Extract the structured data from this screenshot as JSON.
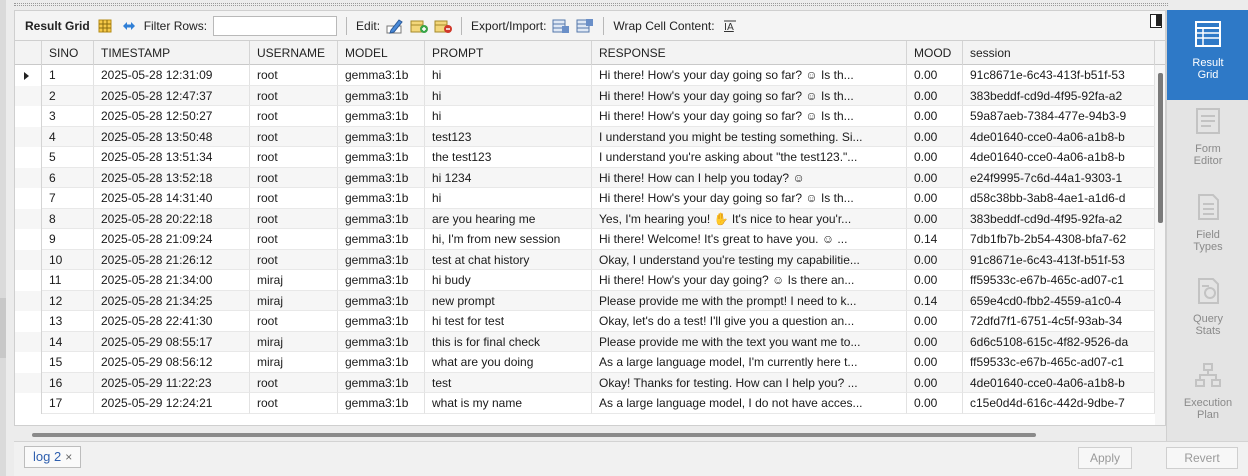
{
  "toolbar": {
    "result_grid_label": "Result Grid",
    "filter_rows_label": "Filter Rows:",
    "filter_value": "",
    "edit_label": "Edit:",
    "export_import_label": "Export/Import:",
    "wrap_cell_label": "Wrap Cell Content:"
  },
  "grid": {
    "columns": [
      "SINO",
      "TIMESTAMP",
      "USERNAME",
      "MODEL",
      "PROMPT",
      "RESPONSE",
      "MOOD",
      "session"
    ],
    "rows": [
      {
        "sino": "1",
        "timestamp": "2025-05-28 12:31:09",
        "username": "root",
        "model": "gemma3:1b",
        "prompt": "hi",
        "response": "Hi there! How's your day going so far? ☺ Is th...",
        "mood": "0.00",
        "session": "91c8671e-6c43-413f-b51f-53"
      },
      {
        "sino": "2",
        "timestamp": "2025-05-28 12:47:37",
        "username": "root",
        "model": "gemma3:1b",
        "prompt": "hi",
        "response": "Hi there! How's your day going so far? ☺ Is th...",
        "mood": "0.00",
        "session": "383beddf-cd9d-4f95-92fa-a2"
      },
      {
        "sino": "3",
        "timestamp": "2025-05-28 12:50:27",
        "username": "root",
        "model": "gemma3:1b",
        "prompt": "hi",
        "response": "Hi there! How's your day going so far? ☺ Is th...",
        "mood": "0.00",
        "session": "59a87aeb-7384-477e-94b3-9"
      },
      {
        "sino": "4",
        "timestamp": "2025-05-28 13:50:48",
        "username": "root",
        "model": "gemma3:1b",
        "prompt": "test123",
        "response": "I understand you might be testing something. Si...",
        "mood": "0.00",
        "session": "4de01640-cce0-4a06-a1b8-b"
      },
      {
        "sino": "5",
        "timestamp": "2025-05-28 13:51:34",
        "username": "root",
        "model": "gemma3:1b",
        "prompt": "the test123",
        "response": "I understand you're asking about \"the test123.\"...",
        "mood": "0.00",
        "session": "4de01640-cce0-4a06-a1b8-b"
      },
      {
        "sino": "6",
        "timestamp": "2025-05-28 13:52:18",
        "username": "root",
        "model": "gemma3:1b",
        "prompt": "hi 1234",
        "response": "Hi there! How can I help you today? ☺",
        "mood": "0.00",
        "session": "e24f9995-7c6d-44a1-9303-1"
      },
      {
        "sino": "7",
        "timestamp": "2025-05-28 14:31:40",
        "username": "root",
        "model": "gemma3:1b",
        "prompt": "hi",
        "response": "Hi there! How's your day going so far? ☺ Is th...",
        "mood": "0.00",
        "session": "d58c38bb-3ab8-4ae1-a1d6-d"
      },
      {
        "sino": "8",
        "timestamp": "2025-05-28 20:22:18",
        "username": "root",
        "model": "gemma3:1b",
        "prompt": "are you hearing me",
        "response": "Yes, I'm hearing you! ✋ It's nice to hear you'r...",
        "mood": "0.00",
        "session": "383beddf-cd9d-4f95-92fa-a2"
      },
      {
        "sino": "9",
        "timestamp": "2025-05-28 21:09:24",
        "username": "root",
        "model": "gemma3:1b",
        "prompt": "hi, I'm from new session",
        "response": "Hi there! Welcome! It's great to have you. ☺ ...",
        "mood": "0.14",
        "session": "7db1fb7b-2b54-4308-bfa7-62"
      },
      {
        "sino": "10",
        "timestamp": "2025-05-28 21:26:12",
        "username": "root",
        "model": "gemma3:1b",
        "prompt": "test at chat history",
        "response": "Okay, I understand you're testing my capabilitie...",
        "mood": "0.00",
        "session": "91c8671e-6c43-413f-b51f-53"
      },
      {
        "sino": "11",
        "timestamp": "2025-05-28 21:34:00",
        "username": "miraj",
        "model": "gemma3:1b",
        "prompt": "hi budy",
        "response": "Hi there! How's your day going? ☺ Is there an...",
        "mood": "0.00",
        "session": "ff59533c-e67b-465c-ad07-c1"
      },
      {
        "sino": "12",
        "timestamp": "2025-05-28 21:34:25",
        "username": "miraj",
        "model": "gemma3:1b",
        "prompt": "new prompt",
        "response": "Please provide me with the prompt! I need to k...",
        "mood": "0.14",
        "session": "659e4cd0-fbb2-4559-a1c0-4"
      },
      {
        "sino": "13",
        "timestamp": "2025-05-28 22:41:30",
        "username": "root",
        "model": "gemma3:1b",
        "prompt": "hi test for test",
        "response": "Okay, let's do a test! I'll give you a question an...",
        "mood": "0.00",
        "session": "72dfd7f1-6751-4c5f-93ab-34"
      },
      {
        "sino": "14",
        "timestamp": "2025-05-29 08:55:17",
        "username": "miraj",
        "model": "gemma3:1b",
        "prompt": "this is for final check",
        "response": "Please provide me with the text you want me to...",
        "mood": "0.00",
        "session": "6d6c5108-615c-4f82-9526-da"
      },
      {
        "sino": "15",
        "timestamp": "2025-05-29 08:56:12",
        "username": "miraj",
        "model": "gemma3:1b",
        "prompt": "what are you doing",
        "response": "As a large language model, I'm currently here t...",
        "mood": "0.00",
        "session": "ff59533c-e67b-465c-ad07-c1"
      },
      {
        "sino": "16",
        "timestamp": "2025-05-29 11:22:23",
        "username": "root",
        "model": "gemma3:1b",
        "prompt": "test",
        "response": "Okay! Thanks for testing. How can I help you? ...",
        "mood": "0.00",
        "session": "4de01640-cce0-4a06-a1b8-b"
      },
      {
        "sino": "17",
        "timestamp": "2025-05-29 12:24:21",
        "username": "root",
        "model": "gemma3:1b",
        "prompt": "what is my name",
        "response": "As a large language model, I do not have acces...",
        "mood": "0.00",
        "session": "c15e0d4d-616c-442d-9dbe-7"
      }
    ]
  },
  "bottom": {
    "tab_label": "log 2",
    "tab_close": "×",
    "apply_label": "Apply",
    "revert_label": "Revert"
  },
  "side_panel": {
    "items": [
      {
        "label_line1": "Result",
        "label_line2": "Grid",
        "icon": "result-grid-icon"
      },
      {
        "label_line1": "Form",
        "label_line2": "Editor",
        "icon": "form-editor-icon"
      },
      {
        "label_line1": "Field",
        "label_line2": "Types",
        "icon": "field-types-icon"
      },
      {
        "label_line1": "Query",
        "label_line2": "Stats",
        "icon": "query-stats-icon"
      },
      {
        "label_line1": "Execution",
        "label_line2": "Plan",
        "icon": "execution-plan-icon"
      }
    ]
  }
}
